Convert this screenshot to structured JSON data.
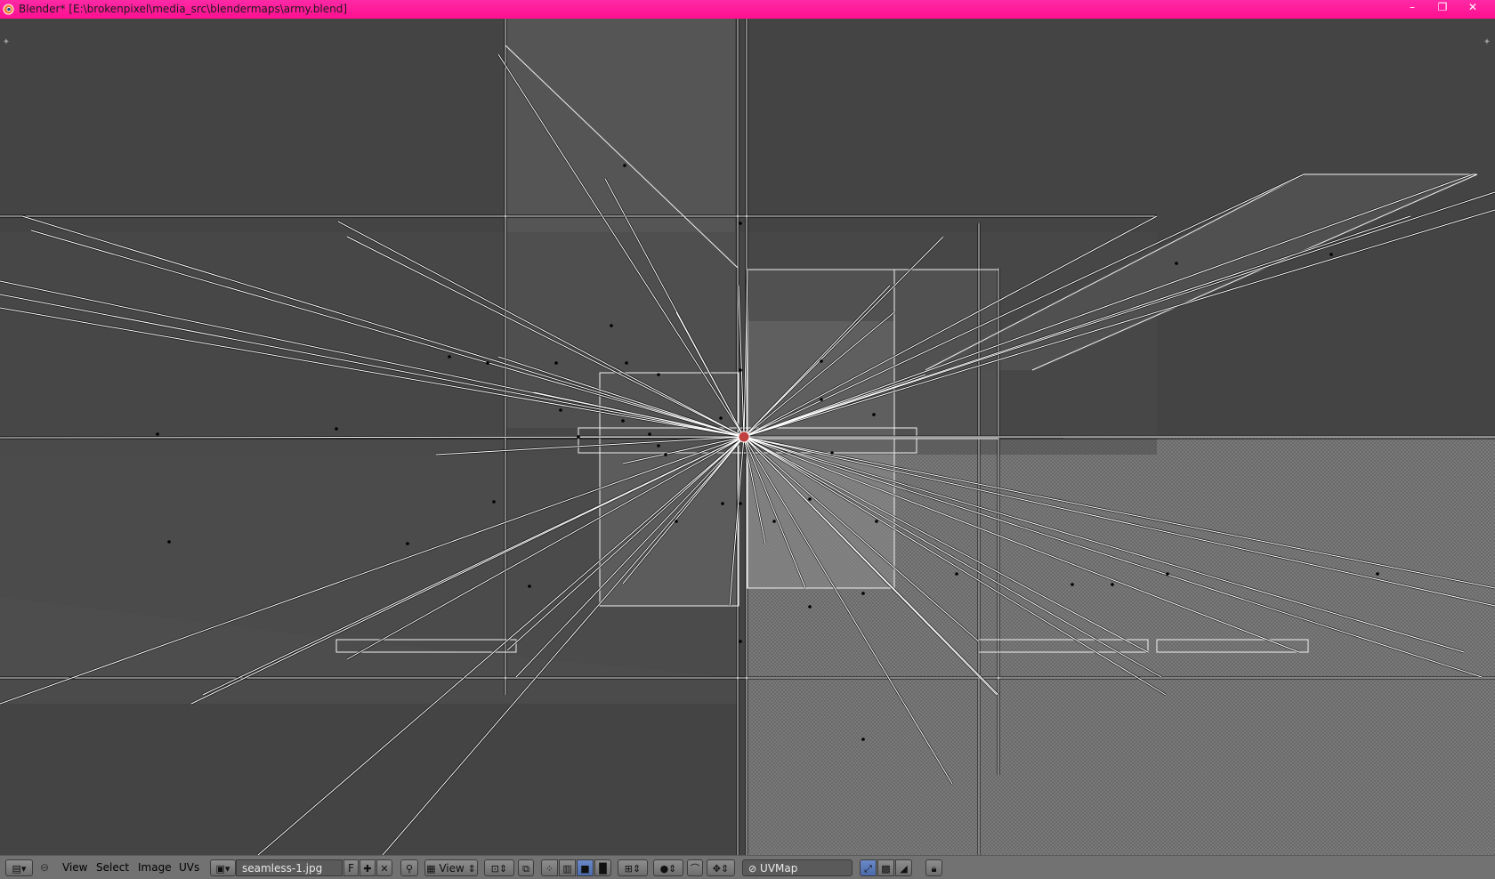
{
  "window": {
    "title": "Blender* [E:\\brokenpixel\\media_src\\blendermaps\\army.blend]",
    "controls": {
      "minimize": "–",
      "restore": "❐",
      "close": "✕"
    }
  },
  "header": {
    "menus": {
      "view": "View",
      "select": "Select",
      "image": "Image",
      "uvs": "UVs"
    },
    "image_name": "seamless-1.jpg",
    "fake_user": "F",
    "view_dropdown": "View",
    "uv_map": "UVMap"
  },
  "colors": {
    "titlebar": "#ff1493",
    "viewport_bg": "#444444",
    "header_bg": "#727272",
    "active_button": "#5677b8"
  },
  "icons": [
    "blender-logo-icon",
    "editor-type-icon",
    "image-browse-icon",
    "new-image-icon",
    "unlink-icon",
    "pin-icon",
    "image-icon",
    "snap-icon",
    "pivot-icon",
    "proportional-icon",
    "uv-sync-icon",
    "lock-icon"
  ]
}
